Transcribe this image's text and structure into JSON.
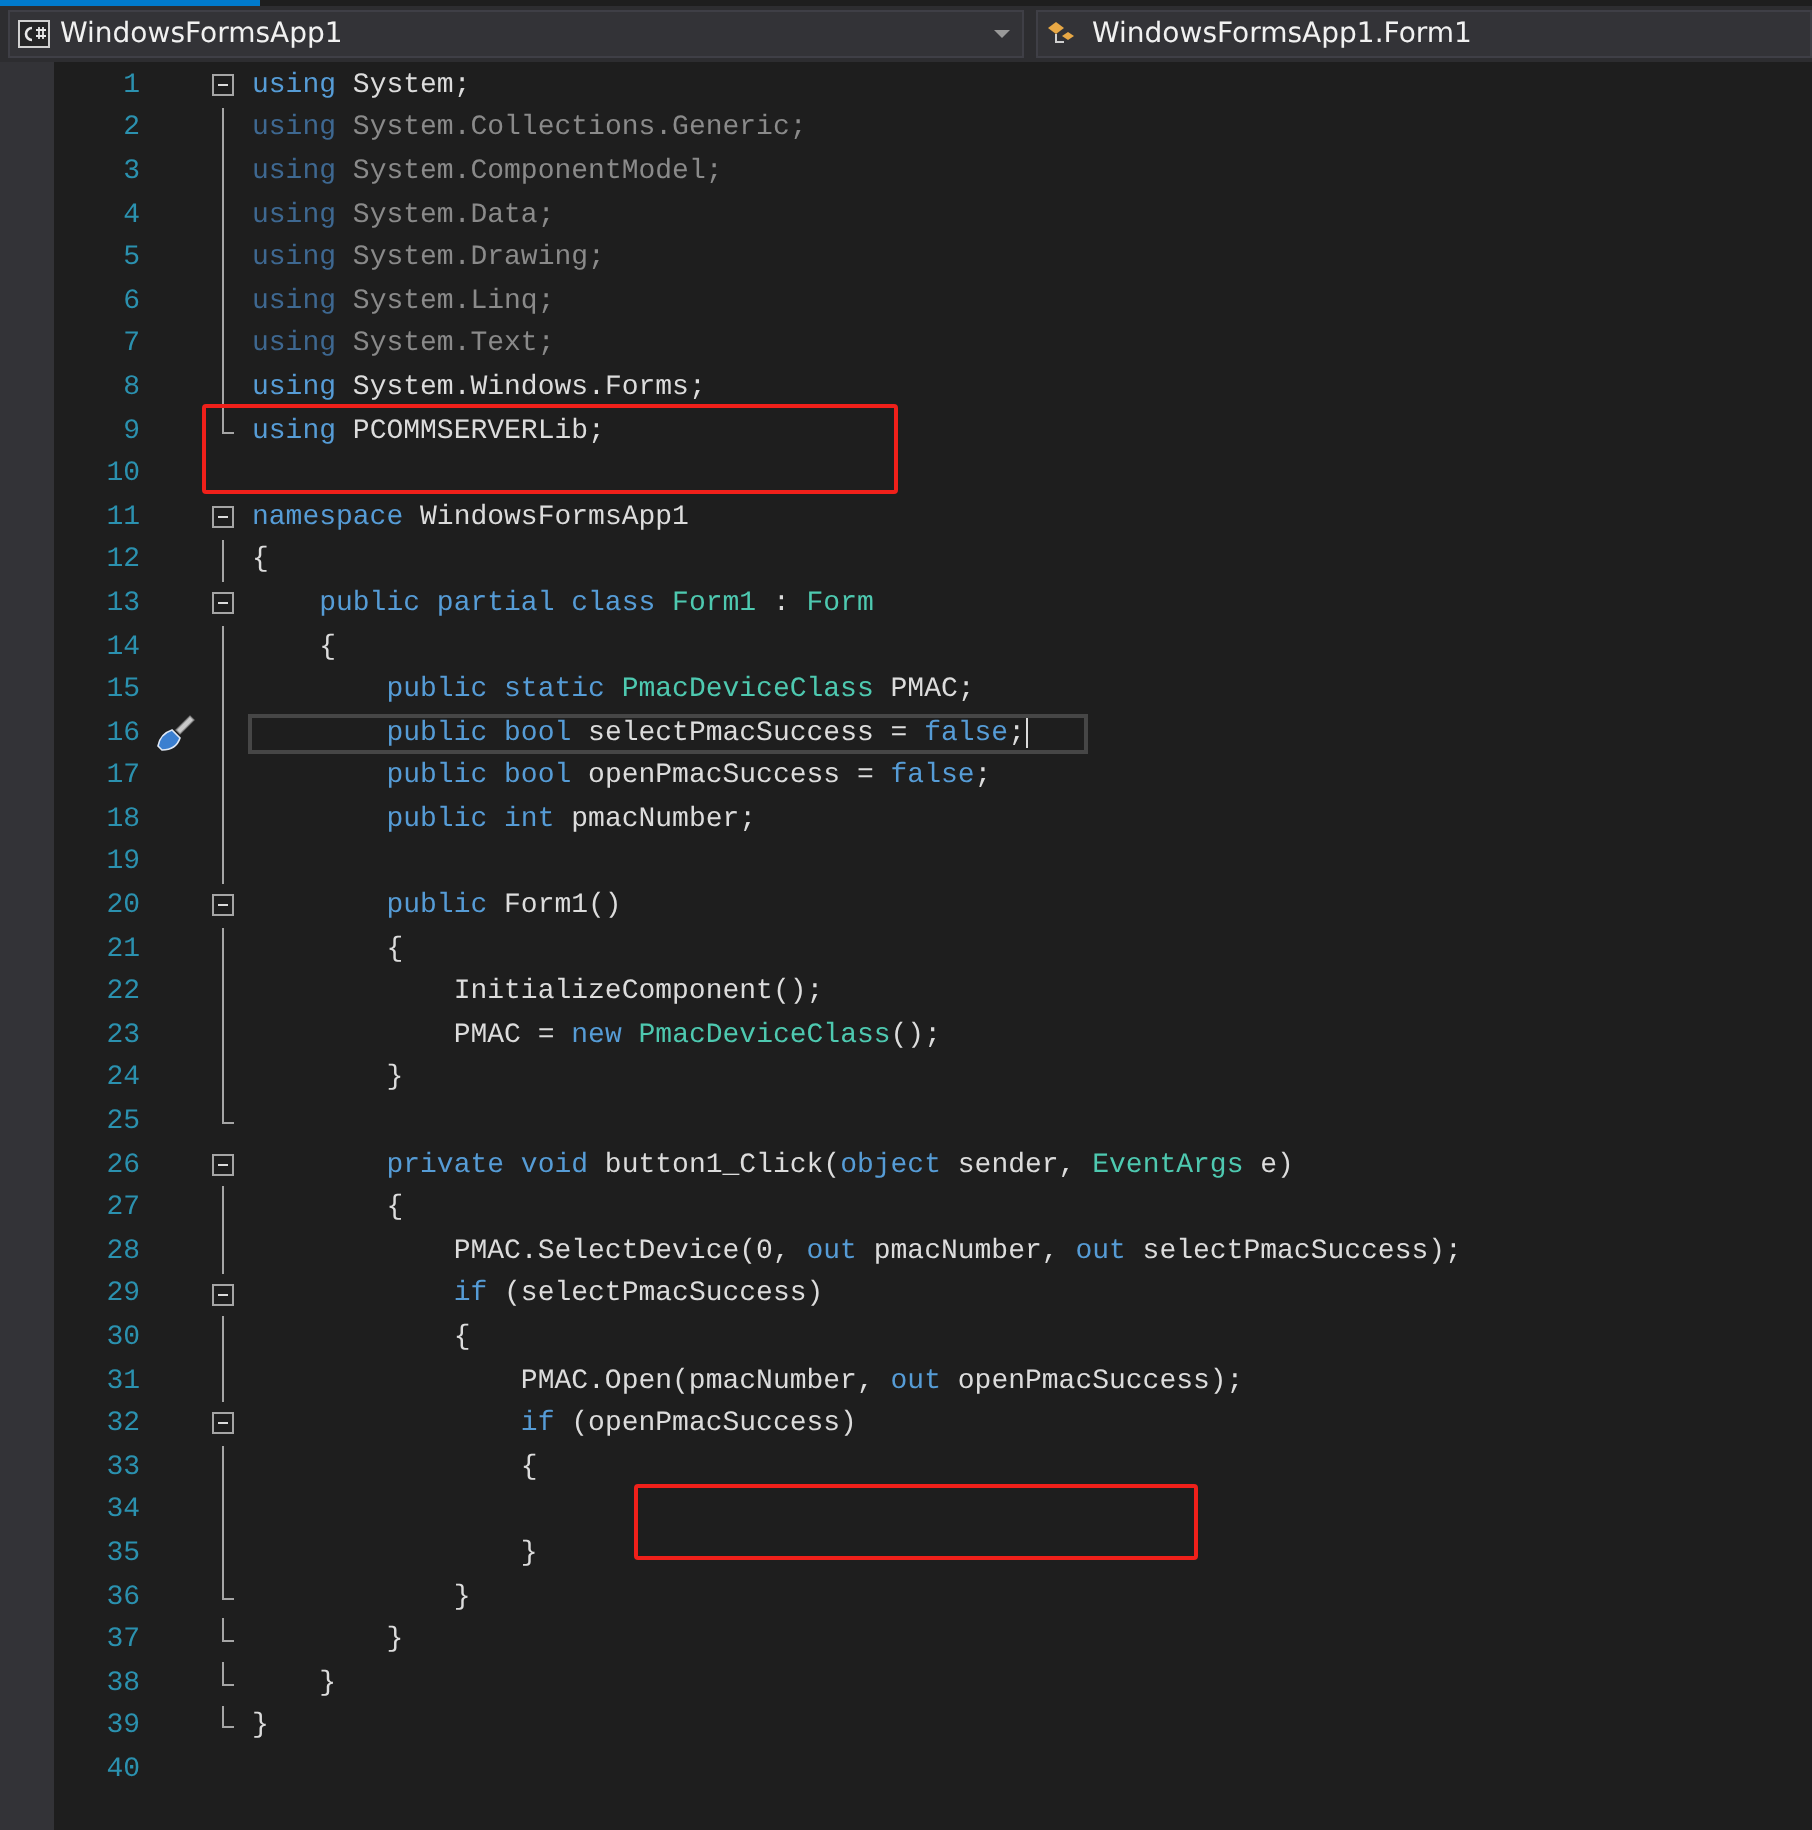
{
  "header": {
    "project_dropdown": {
      "label": "WindowsFormsApp1"
    },
    "class_dropdown": {
      "label": "WindowsFormsApp1.Form1"
    }
  },
  "lines": [
    {
      "number": "1",
      "fold_start": true,
      "tokens": [
        {
          "t": "using",
          "kind": "keyword"
        },
        {
          "t": " System;",
          "kind": "plain"
        }
      ]
    },
    {
      "number": "2",
      "fold_guide": true,
      "faded": true,
      "tokens": [
        {
          "t": "using",
          "kind": "keyword"
        },
        {
          "t": " System.Collections.Generic;",
          "kind": "plain"
        }
      ]
    },
    {
      "number": "3",
      "fold_guide": true,
      "faded": true,
      "tokens": [
        {
          "t": "using",
          "kind": "keyword"
        },
        {
          "t": " System.ComponentModel;",
          "kind": "plain"
        }
      ]
    },
    {
      "number": "4",
      "fold_guide": true,
      "faded": true,
      "tokens": [
        {
          "t": "using",
          "kind": "keyword"
        },
        {
          "t": " System.Data;",
          "kind": "plain"
        }
      ]
    },
    {
      "number": "5",
      "fold_guide": true,
      "faded": true,
      "tokens": [
        {
          "t": "using",
          "kind": "keyword"
        },
        {
          "t": " System.Drawing;",
          "kind": "plain"
        }
      ]
    },
    {
      "number": "6",
      "fold_guide": true,
      "faded": true,
      "tokens": [
        {
          "t": "using",
          "kind": "keyword"
        },
        {
          "t": " System.Linq;",
          "kind": "plain"
        }
      ]
    },
    {
      "number": "7",
      "fold_guide": true,
      "faded": true,
      "tokens": [
        {
          "t": "using",
          "kind": "keyword"
        },
        {
          "t": " System.Text;",
          "kind": "plain"
        }
      ]
    },
    {
      "number": "8",
      "fold_guide": true,
      "faded": false,
      "tokens": [
        {
          "t": "using",
          "kind": "keyword"
        },
        {
          "t": " System.Windows.Forms;",
          "kind": "plain"
        }
      ]
    },
    {
      "number": "9",
      "fold_end": true,
      "boxed": true,
      "tokens": [
        {
          "t": "using",
          "kind": "keyword"
        },
        {
          "t": " PCOMMSERVERLib;",
          "kind": "plain"
        }
      ]
    },
    {
      "number": "10"
    },
    {
      "number": "11",
      "fold_start": true,
      "tokens": [
        {
          "t": "namespace",
          "kind": "keyword"
        },
        {
          "t": " WindowsFormsApp1",
          "kind": "plain"
        }
      ]
    },
    {
      "number": "12",
      "fold_guide": true,
      "tokens": [
        {
          "t": "{",
          "kind": "plain"
        }
      ]
    },
    {
      "number": "13",
      "fold_start": true,
      "tokens": [
        {
          "t": "    public partial class",
          "kind": "keyword"
        },
        {
          "t": " Form1",
          "kind": "type"
        },
        {
          "t": " : ",
          "kind": "plain"
        },
        {
          "t": "Form",
          "kind": "type"
        }
      ]
    },
    {
      "number": "14",
      "fold_guide": true,
      "tokens": [
        {
          "t": "    {",
          "kind": "plain"
        }
      ]
    },
    {
      "number": "15",
      "fold_guide": true,
      "tokens": [
        {
          "t": "        public static",
          "kind": "keyword"
        },
        {
          "t": " PmacDeviceClass",
          "kind": "type"
        },
        {
          "t": " PMAC;",
          "kind": "plain"
        }
      ]
    },
    {
      "number": "16",
      "fold_guide": true,
      "current": true,
      "quick_action": true,
      "tokens": [
        {
          "t": "        public bool",
          "kind": "keyword"
        },
        {
          "t": " selectPmacSuccess = ",
          "kind": "plain"
        },
        {
          "t": "false",
          "kind": "keyword"
        },
        {
          "t": ";",
          "kind": "plain"
        }
      ]
    },
    {
      "number": "17",
      "fold_guide": true,
      "tokens": [
        {
          "t": "        public bool",
          "kind": "keyword"
        },
        {
          "t": " openPmacSuccess = ",
          "kind": "plain"
        },
        {
          "t": "false",
          "kind": "keyword"
        },
        {
          "t": ";",
          "kind": "plain"
        }
      ]
    },
    {
      "number": "18",
      "fold_guide": true,
      "tokens": [
        {
          "t": "        public int",
          "kind": "keyword"
        },
        {
          "t": " pmacNumber;",
          "kind": "plain"
        }
      ]
    },
    {
      "number": "19",
      "fold_guide": true
    },
    {
      "number": "20",
      "fold_start": true,
      "tokens": [
        {
          "t": "        public",
          "kind": "keyword"
        },
        {
          "t": " Form1()",
          "kind": "plain"
        }
      ]
    },
    {
      "number": "21",
      "fold_guide": true,
      "tokens": [
        {
          "t": "        {",
          "kind": "plain"
        }
      ]
    },
    {
      "number": "22",
      "fold_guide": true,
      "tokens": [
        {
          "t": "            InitializeComponent();",
          "kind": "plain"
        }
      ]
    },
    {
      "number": "23",
      "fold_guide": true,
      "tokens": [
        {
          "t": "            PMAC = ",
          "kind": "plain"
        },
        {
          "t": "new",
          "kind": "keyword"
        },
        {
          "t": " PmacDeviceClass",
          "kind": "type"
        },
        {
          "t": "();",
          "kind": "plain"
        }
      ]
    },
    {
      "number": "24",
      "fold_guide": true,
      "tokens": [
        {
          "t": "        }",
          "kind": "plain"
        }
      ]
    },
    {
      "number": "25",
      "fold_end": true
    },
    {
      "number": "26",
      "fold_start": true,
      "tokens": [
        {
          "t": "        private void",
          "kind": "keyword"
        },
        {
          "t": " button1_Click(",
          "kind": "plain"
        },
        {
          "t": "object",
          "kind": "keyword"
        },
        {
          "t": " sender, ",
          "kind": "plain"
        },
        {
          "t": "EventArgs",
          "kind": "type"
        },
        {
          "t": " e)",
          "kind": "plain"
        }
      ]
    },
    {
      "number": "27",
      "fold_guide": true,
      "tokens": [
        {
          "t": "        {",
          "kind": "plain"
        }
      ]
    },
    {
      "number": "28",
      "fold_guide": true,
      "tokens": [
        {
          "t": "            PMAC.SelectDevice(0, ",
          "kind": "plain"
        },
        {
          "t": "out",
          "kind": "keyword"
        },
        {
          "t": " pmacNumber, ",
          "kind": "plain"
        },
        {
          "t": "out",
          "kind": "keyword"
        },
        {
          "t": " selectPmacSuccess);",
          "kind": "plain"
        }
      ]
    },
    {
      "number": "29",
      "fold_start": true,
      "tokens": [
        {
          "t": "            if",
          "kind": "keyword"
        },
        {
          "t": " (selectPmacSuccess)",
          "kind": "plain"
        }
      ]
    },
    {
      "number": "30",
      "fold_guide": true,
      "tokens": [
        {
          "t": "            {",
          "kind": "plain"
        }
      ]
    },
    {
      "number": "31",
      "fold_guide": true,
      "tokens": [
        {
          "t": "                PMAC.Open(pmacNumber, ",
          "kind": "plain"
        },
        {
          "t": "out",
          "kind": "keyword"
        },
        {
          "t": " openPmacSuccess);",
          "kind": "plain"
        }
      ]
    },
    {
      "number": "32",
      "fold_start": true,
      "tokens": [
        {
          "t": "                if",
          "kind": "keyword"
        },
        {
          "t": " (openPmacSuccess)",
          "kind": "plain"
        }
      ]
    },
    {
      "number": "33",
      "fold_guide": true,
      "tokens": [
        {
          "t": "                {",
          "kind": "plain"
        }
      ]
    },
    {
      "number": "34",
      "fold_guide": true,
      "boxed": true
    },
    {
      "number": "35",
      "fold_guide": true,
      "tokens": [
        {
          "t": "                }",
          "kind": "plain"
        }
      ]
    },
    {
      "number": "36",
      "fold_end": true,
      "tokens": [
        {
          "t": "            }",
          "kind": "plain"
        }
      ]
    },
    {
      "number": "37",
      "fold_end": true,
      "tokens": [
        {
          "t": "        }",
          "kind": "plain"
        }
      ]
    },
    {
      "number": "38",
      "fold_end": true,
      "tokens": [
        {
          "t": "    }",
          "kind": "plain"
        }
      ]
    },
    {
      "number": "39",
      "fold_end": true,
      "tokens": [
        {
          "t": "}",
          "kind": "plain"
        }
      ]
    },
    {
      "number": "40"
    }
  ]
}
